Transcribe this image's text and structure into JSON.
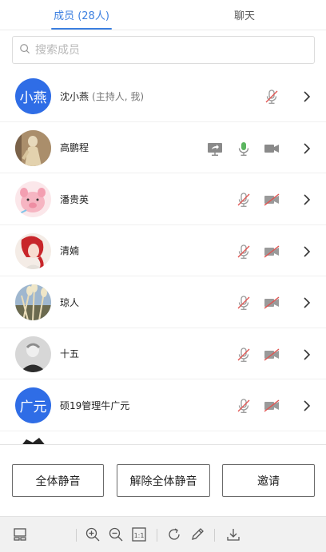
{
  "tabs": [
    {
      "label": "成员 (28人)",
      "active": true
    },
    {
      "label": "聊天",
      "active": false
    }
  ],
  "search": {
    "placeholder": "搜索成员"
  },
  "members": [
    {
      "name": "沈小燕",
      "role": "(主持人, 我)",
      "avatar_text": "小燕",
      "mic": "muted",
      "camera": "none",
      "sharing": false
    },
    {
      "name": "高鹏程",
      "avatar_image": "statue-photo",
      "mic": "on",
      "camera": "on",
      "sharing": true
    },
    {
      "name": "潘贵英",
      "avatar_image": "pink-cartoon-pig",
      "mic": "muted",
      "camera": "off",
      "sharing": false
    },
    {
      "name": "清婻",
      "avatar_image": "red-hair-girl-illustration",
      "mic": "muted",
      "camera": "off",
      "sharing": false
    },
    {
      "name": "琼人",
      "avatar_image": "reed-plants-photo",
      "mic": "muted",
      "camera": "off",
      "sharing": false
    },
    {
      "name": "十五",
      "avatar_image": "person-portrait-photo",
      "mic": "muted",
      "camera": "off",
      "sharing": false
    },
    {
      "name": "硕19管理牛广元",
      "avatar_text": "广元",
      "mic": "muted",
      "camera": "off",
      "sharing": false
    }
  ],
  "actions": {
    "mute_all": "全体静音",
    "unmute_all": "解除全体静音",
    "invite": "邀请"
  },
  "toolbar": {
    "icons": [
      "layout-icon",
      "zoom-in-icon",
      "zoom-out-icon",
      "actual-size-icon",
      "rotate-icon",
      "pen-icon",
      "download-icon"
    ],
    "actual_size_label": "1:1"
  },
  "colors": {
    "accent": "#3b7fe0",
    "avatar_blue": "#2f6de6",
    "muted_red": "#e0524f",
    "mic_green": "#5bb55f"
  }
}
